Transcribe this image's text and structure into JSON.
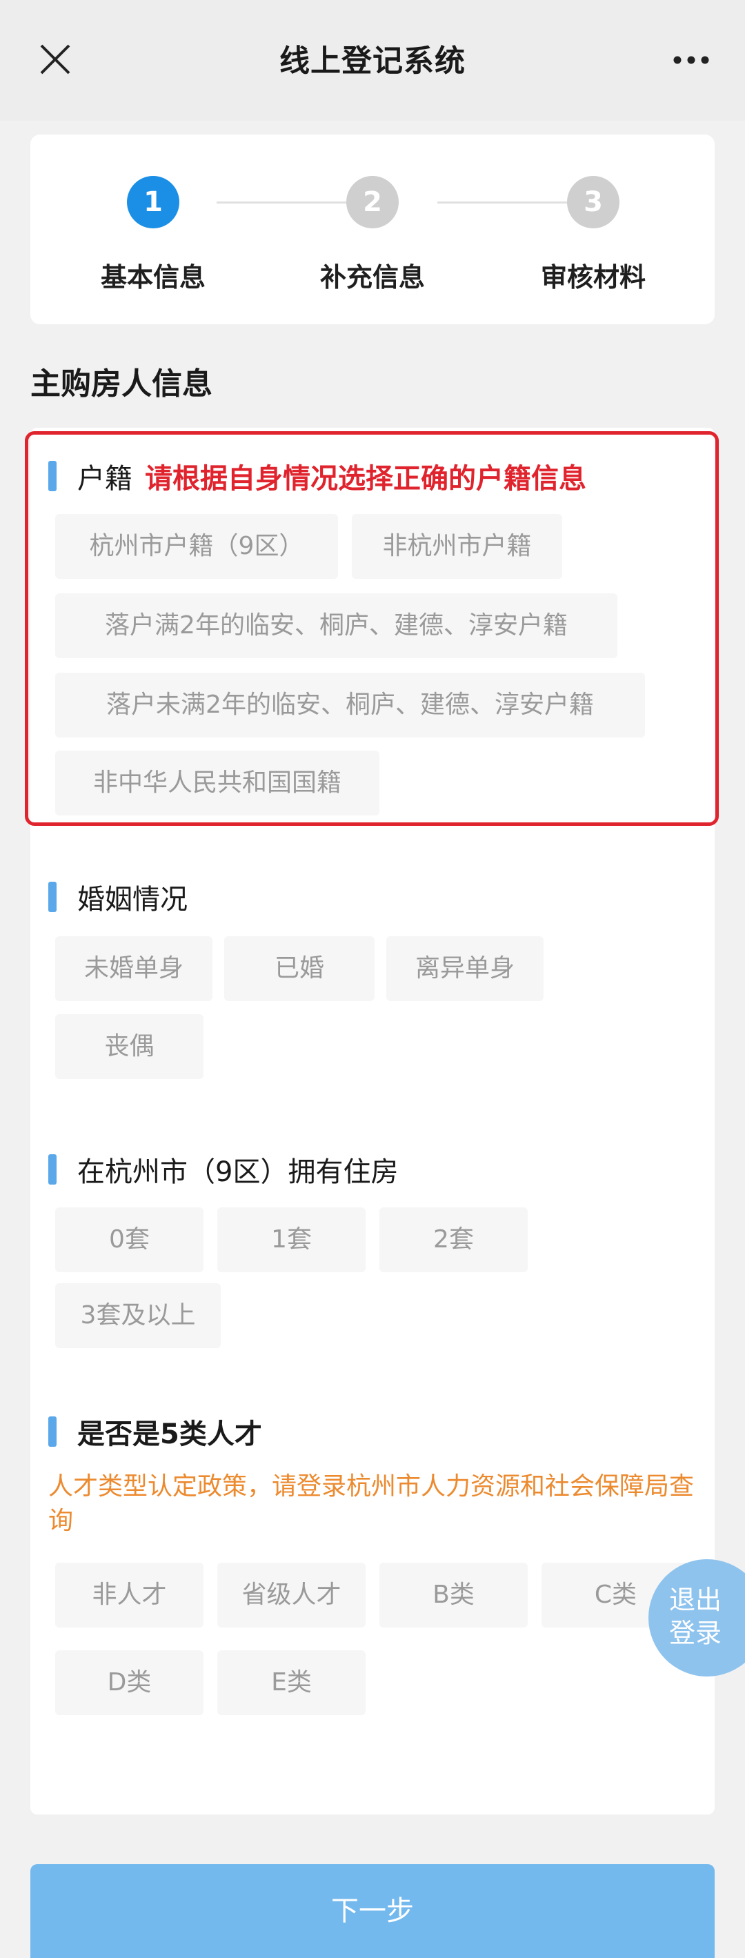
{
  "header": {
    "title": "线上登记系统",
    "close_icon": "close-icon",
    "more_icon": "more-dots-icon"
  },
  "steps": [
    {
      "number": "1",
      "label": "基本信息",
      "state": "active"
    },
    {
      "number": "2",
      "label": "补充信息",
      "state": "inactive"
    },
    {
      "number": "3",
      "label": "审核材料",
      "state": "inactive"
    }
  ],
  "section_title": "主购房人信息",
  "household": {
    "label": "户籍",
    "hint": "请根据自身情况选择正确的户籍信息",
    "options": [
      "杭州市户籍（9区）",
      "非杭州市户籍",
      "落户满2年的临安、桐庐、建德、淳安户籍",
      "落户未满2年的临安、桐庐、建德、淳安户籍",
      "非中华人民共和国国籍"
    ]
  },
  "marriage": {
    "label": "婚姻情况",
    "options": [
      "未婚单身",
      "已婚",
      "离异单身",
      "丧偶"
    ]
  },
  "housing": {
    "label": "在杭州市（9区）拥有住房",
    "options": [
      "0套",
      "1套",
      "2套",
      "3套及以上"
    ]
  },
  "talent": {
    "label": "是否是5类人才",
    "hint": "人才类型认定政策，请登录杭州市人力资源和社会保障局查询",
    "options": [
      "非人才",
      "省级人才",
      "B类",
      "C类",
      "D类",
      "E类"
    ]
  },
  "logout": {
    "line1": "退出",
    "line2": "登录"
  },
  "next_button": "下一步",
  "colors": {
    "accent": "#1b8fe6",
    "highlight_red": "#e0242e",
    "hint_orange": "#ec8a2f",
    "next_button": "#74b9ee"
  }
}
